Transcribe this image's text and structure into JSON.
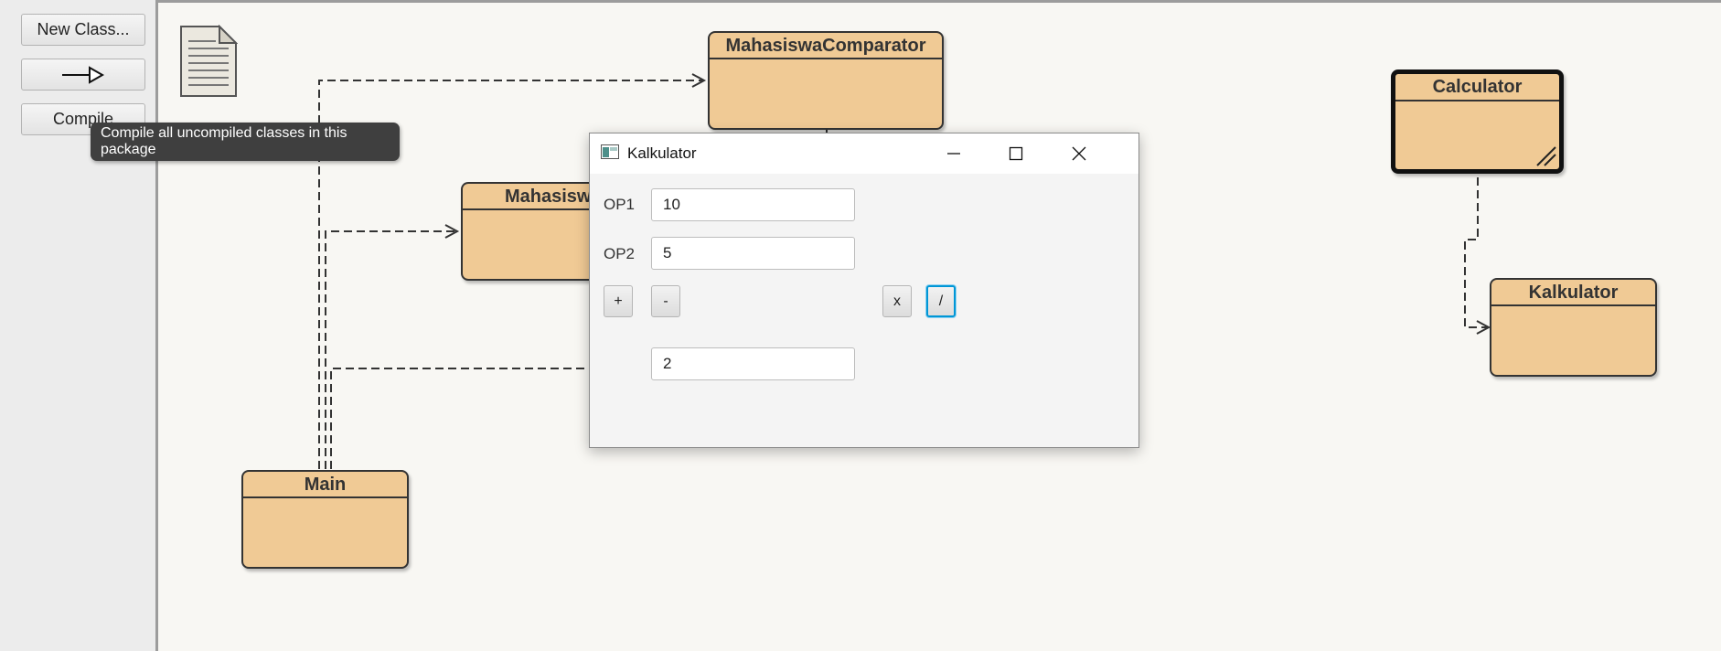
{
  "sidebar": {
    "new_class_label": "New Class...",
    "arrow_icon": "inheritance-arrow-icon",
    "compile_label": "Compile"
  },
  "tooltip": {
    "text": "Compile all uncompiled classes in this package"
  },
  "diagram": {
    "note_icon": "readme-document-icon",
    "classes": {
      "mahasiswa_comparator": "MahasiswaComparator",
      "mahasiswa": "Mahasiswa",
      "main": "Main",
      "calculator": "Calculator",
      "kalkulator": "Kalkulator"
    }
  },
  "window": {
    "title": "Kalkulator",
    "op1_label": "OP1",
    "op1_value": "10",
    "op2_label": "OP2",
    "op2_value": "5",
    "buttons": {
      "add": "+",
      "subtract": "-",
      "multiply": "x",
      "divide": "/"
    },
    "result_value": "2",
    "focused_button": "divide"
  },
  "colors": {
    "class_fill": "#f0ca95",
    "canvas_bg": "#f8f7f3",
    "focus_ring": "#0096d6",
    "tooltip_bg": "#3f3f3f"
  }
}
